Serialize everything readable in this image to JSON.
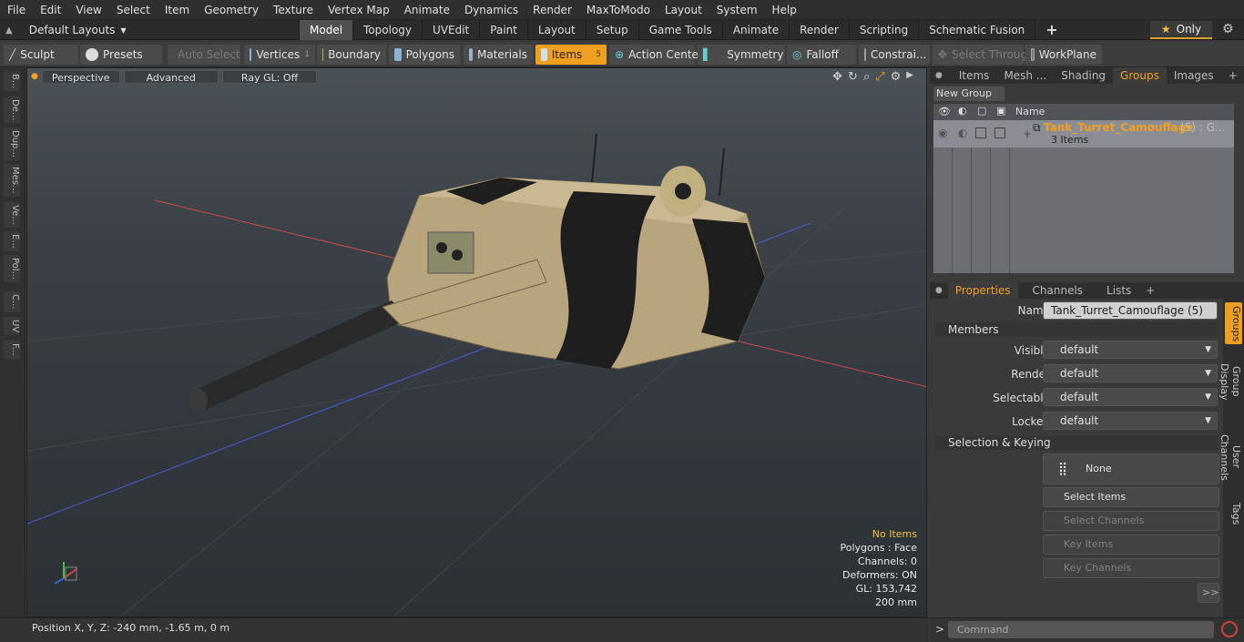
{
  "menu": [
    "File",
    "Edit",
    "View",
    "Select",
    "Item",
    "Geometry",
    "Texture",
    "Vertex Map",
    "Animate",
    "Dynamics",
    "Render",
    "MaxToModo",
    "Layout",
    "System",
    "Help"
  ],
  "layout_dropdown": "Default Layouts",
  "tabs": [
    "Model",
    "Topology",
    "UVEdit",
    "Paint",
    "Layout",
    "Setup",
    "Game Tools",
    "Animate",
    "Render",
    "Scripting",
    "Schematic Fusion"
  ],
  "only_label": "Only",
  "toolbar": {
    "sculpt": "Sculpt",
    "presets": "Presets",
    "auto_select": "Auto Select",
    "vertices": "Vertices",
    "vertices_count": "1",
    "boundary": "Boundary",
    "polygons": "Polygons",
    "materials": "Materials",
    "items": "Items",
    "items_count": "5",
    "action_center": "Action Center",
    "symmetry": "Symmetry",
    "falloff": "Falloff",
    "constraints": "Constrai...",
    "select_through": "Select Through",
    "workplane": "WorkPlane"
  },
  "left_strip": [
    "B...",
    "De...",
    "Dup...",
    "Mes...",
    "Ve...",
    "E...",
    "Pol...",
    "C...",
    "UV",
    "F..."
  ],
  "viewport": {
    "perspective": "Perspective",
    "advanced": "Advanced",
    "raygl": "Ray GL: Off",
    "stats": [
      "No Items",
      "Polygons : Face",
      "Channels: 0",
      "Deformers: ON",
      "GL: 153,742",
      "200 mm"
    ]
  },
  "status": "Position X, Y, Z:   -240 mm, -1.65 m, 0 m",
  "right_tabs": [
    "Items",
    "Mesh ...",
    "Shading",
    "Groups",
    "Images"
  ],
  "groups": {
    "new_group": "New Group",
    "name_header": "Name",
    "item_name": "Tank_Turret_Camouflage",
    "item_suffix": "(5) : G...",
    "item_count": "3 Items"
  },
  "props_tabs": [
    "Properties",
    "Channels",
    "Lists"
  ],
  "props": {
    "name_label": "Name",
    "name_value": "Tank_Turret_Camouflage (5)",
    "members": "Members",
    "visible_label": "Visible",
    "render_label": "Render",
    "selectable_label": "Selectable",
    "locked_label": "Locked",
    "default": "default",
    "selection_keying": "Selection & Keying",
    "none": "None",
    "select_items": "Select Items",
    "select_channels": "Select Channels",
    "key_items": "Key Items",
    "key_channels": "Key Channels",
    "more": ">>"
  },
  "vtabs": [
    "Groups",
    "Group Display",
    "User Channels",
    "Tags"
  ],
  "command_placeholder": "Command",
  "colors": {
    "accent": "#f0a020",
    "camo_tan": "#b8a57e",
    "camo_black": "#1e1e1e"
  }
}
